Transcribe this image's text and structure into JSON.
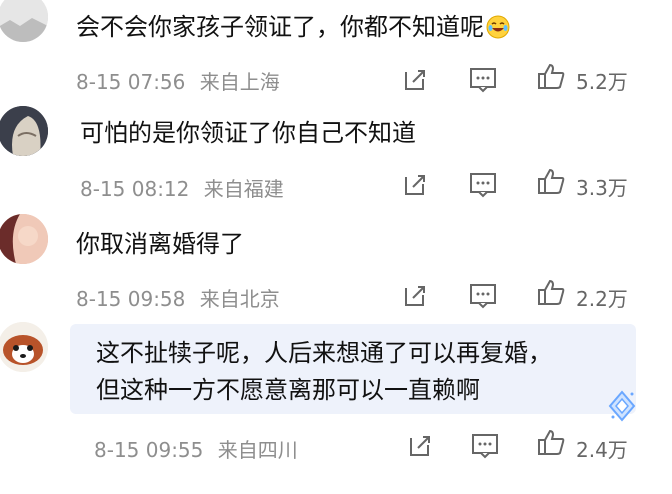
{
  "comments": [
    {
      "text": "会不会你家孩子领证了，你都不知道呢",
      "time": "8-15 07:56",
      "location": "来自上海",
      "likes": "5.2万"
    },
    {
      "text": "可怕的是你领证了你自己不知道",
      "time": "8-15 08:12",
      "location": "来自福建",
      "likes": "3.3万"
    },
    {
      "text": "你取消离婚得了",
      "time": "8-15 09:58",
      "location": "来自北京",
      "likes": "2.2万"
    },
    {
      "text_line1": "这不扯犊子呢，人后来想通了可以再复婚，",
      "text_line2": "但这种一方不愿意离那可以一直赖啊",
      "time": "8-15 09:55",
      "location": "来自四川",
      "likes": "2.4万"
    }
  ],
  "icons": [
    "edit-icon",
    "comment-icon",
    "like-icon",
    "emoji-cry-laugh",
    "avatar",
    "sparkle-icon"
  ],
  "colors": {
    "meta": "#8e8e8e",
    "text": "#111111",
    "highlight": "#eef2fb"
  }
}
